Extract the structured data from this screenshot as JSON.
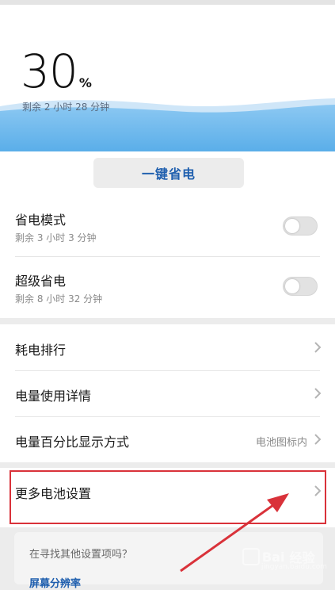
{
  "battery": {
    "percent": "30",
    "percent_sign": "%",
    "remaining": "剩余 2 小时 28 分钟",
    "level_fraction": 0.3
  },
  "actions": {
    "one_click_saver": "一键省电"
  },
  "power_modes": [
    {
      "title": "省电模式",
      "subtitle": "剩余 3 小时 3 分钟",
      "enabled": false
    },
    {
      "title": "超级省电",
      "subtitle": "剩余 8 小时 32 分钟",
      "enabled": false
    }
  ],
  "menu": [
    {
      "title": "耗电排行",
      "value": ""
    },
    {
      "title": "电量使用详情",
      "value": ""
    },
    {
      "title": "电量百分比显示方式",
      "value": "电池图标内"
    }
  ],
  "more_settings": {
    "title": "更多电池设置"
  },
  "suggest": {
    "question": "在寻找其他设置项吗？",
    "link": "屏幕分辨率"
  },
  "watermark": {
    "text": "Bai",
    "text2": "经验",
    "sub": "jingyan.baidu.com"
  },
  "colors": {
    "accent": "#1f5fae",
    "wave": "#5fb0ec",
    "highlight": "#d9323a"
  },
  "icons": {
    "chevron": "chevron-right-icon",
    "arrow": "annotation-arrow-icon"
  }
}
